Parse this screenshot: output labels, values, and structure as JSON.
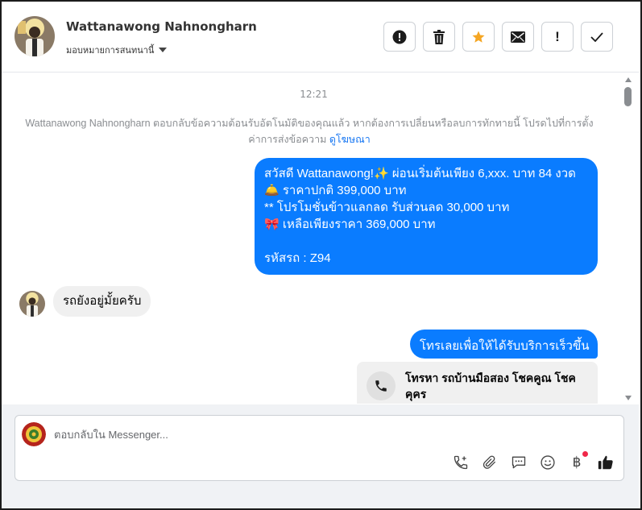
{
  "header": {
    "contact_name": "Wattanawong Nahnongharn",
    "assign_label": "มอบหมายการสนทนานี้",
    "actions": [
      {
        "icon": "alert-circle-icon",
        "label": ""
      },
      {
        "icon": "trash-icon",
        "label": ""
      },
      {
        "icon": "star-icon",
        "label": ""
      },
      {
        "icon": "envelope-icon",
        "label": ""
      },
      {
        "icon": "exclamation-icon",
        "label": "!"
      },
      {
        "icon": "check-icon",
        "label": ""
      }
    ]
  },
  "thread": {
    "timestamp": "12:21",
    "system_message": "Wattanawong Nahnongharn ตอบกลับข้อความต้อนรับอัตโนมัติของคุณแล้ว หากต้องการเปลี่ยนหรือลบการทักทายนี้ โปรดไปที่การตั้งค่าการส่งข้อความ",
    "system_link": "ดูโฆษณา",
    "outgoing_1": {
      "line1": "สวัสดี Wattanawong!✨  ผ่อนเริ่มต้นเพียง 6,xxx. บาท 84 งวด",
      "line2": "🛎️ ราคาปกติ 399,000 บาท",
      "line3": "** โปรโมชั่นข้าวแลกลด รับส่วนลด 30,000 บาท",
      "line4": "🎀  เหลือเพียงราคา 369,000 บาท",
      "line5": "",
      "line6": " รหัสรถ : Z94"
    },
    "incoming_1": "รถยังอยู่มั้ยครับ",
    "outgoing_2": "โทรเลยเพื่อให้ได้รับบริการเร็วขึ้น",
    "call_card_title": "โทรหา รถบ้านมือสอง โชคคูณ โชคคุคร"
  },
  "composer": {
    "placeholder": "ตอบกลับใน Messenger...",
    "tools": [
      "phone-plus-icon",
      "paperclip-icon",
      "saved-reply-icon",
      "emoji-icon",
      "baht-payment-icon",
      "thumbs-up-icon"
    ],
    "baht_symbol": "฿"
  },
  "colors": {
    "accent": "#0a7cff",
    "link": "#1877f2",
    "star": "#f5a623",
    "notification_dot": "#f02849"
  }
}
